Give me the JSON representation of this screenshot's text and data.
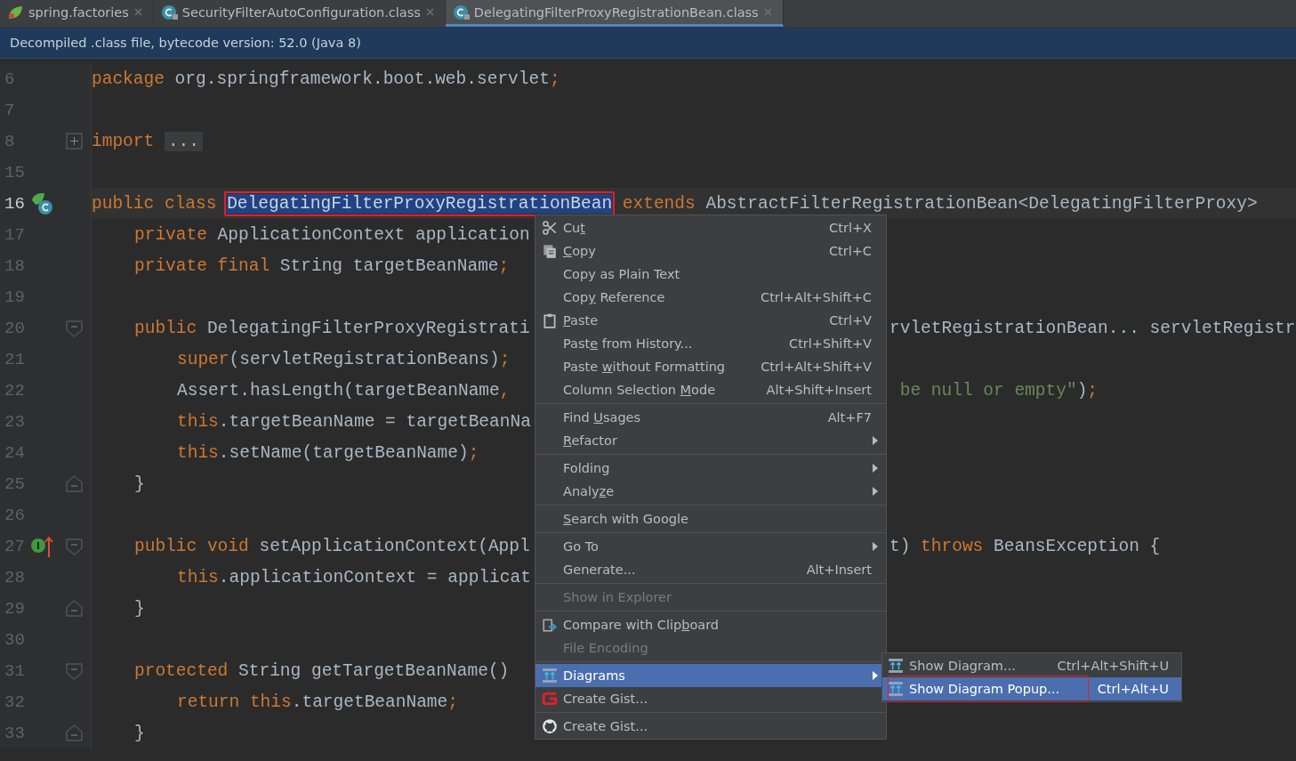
{
  "tabs": [
    {
      "label": "spring.factories",
      "kind": "spring",
      "selected": false
    },
    {
      "label": "SecurityFilterAutoConfiguration.class",
      "kind": "class",
      "selected": false
    },
    {
      "label": "DelegatingFilterProxyRegistrationBean.class",
      "kind": "class",
      "selected": true
    }
  ],
  "banner": "Decompiled .class file, bytecode version: 52.0 (Java 8)",
  "editor": {
    "lines": [
      {
        "number": "6",
        "tokens": [
          {
            "kind": "kw",
            "text": "package"
          },
          {
            "kind": "p",
            "text": " org.springframework.boot.web.servlet"
          },
          {
            "kind": "kw",
            "text": ";"
          }
        ]
      },
      {
        "number": "7"
      },
      {
        "number": "8",
        "fold": {
          "kind": "plus"
        },
        "tokens": [
          {
            "kind": "kw",
            "text": "import "
          },
          {
            "kind": "folded",
            "text": "..."
          }
        ]
      },
      {
        "number": "15"
      },
      {
        "number": "16",
        "current": true,
        "marker": {
          "kind": "class"
        },
        "tokens": [
          {
            "kind": "kw",
            "text": "public class "
          },
          {
            "kind": "sel",
            "text": "DelegatingFilterProxyRegistrationBean",
            "annotated": true
          },
          {
            "kind": "kw",
            "text": " extends"
          },
          {
            "kind": "p",
            "text": " AbstractFilterRegistrationBean<DelegatingFilterProxy>"
          }
        ]
      },
      {
        "number": "17",
        "kind": "member",
        "tokens": [
          {
            "kind": "kw",
            "text": "private"
          },
          {
            "kind": "p",
            "text": " ApplicationContext application"
          }
        ]
      },
      {
        "number": "18",
        "kind": "member",
        "tokens": [
          {
            "kind": "kw",
            "text": "private final"
          },
          {
            "kind": "p",
            "text": " String targetBeanName"
          },
          {
            "kind": "kw",
            "text": ";"
          }
        ]
      },
      {
        "number": "19"
      },
      {
        "number": "20",
        "fold": {
          "kind": "open"
        },
        "kind": "member",
        "tokens": [
          {
            "kind": "kw",
            "text": "public"
          },
          {
            "kind": "p",
            "text": " DelegatingFilterProxyRegistrati"
          }
        ],
        "right": [
          {
            "kind": "p",
            "text": "rvletRegistrationBean... servletRegistr"
          }
        ]
      },
      {
        "number": "21",
        "kind": "body",
        "tokens": [
          {
            "kind": "kw",
            "text": "super"
          },
          {
            "kind": "p",
            "text": "(servletRegistrationBeans)"
          },
          {
            "kind": "kw",
            "text": ";"
          }
        ]
      },
      {
        "number": "22",
        "kind": "body",
        "tokens": [
          {
            "kind": "p",
            "text": "Assert.hasLength(targetBeanName"
          },
          {
            "kind": "kw",
            "text": ","
          }
        ],
        "right": [
          {
            "kind": "str",
            "text": " be null or empty\""
          },
          {
            "kind": "p",
            "text": ")"
          },
          {
            "kind": "kw",
            "text": ";"
          }
        ]
      },
      {
        "number": "23",
        "kind": "body",
        "tokens": [
          {
            "kind": "kw",
            "text": "this"
          },
          {
            "kind": "p",
            "text": ".targetBeanName = targetBeanNa"
          }
        ]
      },
      {
        "number": "24",
        "kind": "body",
        "tokens": [
          {
            "kind": "kw",
            "text": "this"
          },
          {
            "kind": "p",
            "text": ".setName(targetBeanName)"
          },
          {
            "kind": "kw",
            "text": ";"
          }
        ]
      },
      {
        "number": "25",
        "fold": {
          "kind": "close"
        },
        "kind": "member",
        "tokens": [
          {
            "kind": "p",
            "text": "}"
          }
        ]
      },
      {
        "number": "26"
      },
      {
        "number": "27",
        "marker": {
          "kind": "implements"
        },
        "fold": {
          "kind": "open"
        },
        "kind": "member",
        "tokens": [
          {
            "kind": "kw",
            "text": "public void"
          },
          {
            "kind": "p",
            "text": " setApplicationContext(Appl"
          }
        ],
        "right": [
          {
            "kind": "p",
            "text": "t) "
          },
          {
            "kind": "kw",
            "text": "throws"
          },
          {
            "kind": "p",
            "text": " BeansException {"
          }
        ]
      },
      {
        "number": "28",
        "kind": "body",
        "tokens": [
          {
            "kind": "kw",
            "text": "this"
          },
          {
            "kind": "p",
            "text": ".applicationContext = applicat"
          }
        ]
      },
      {
        "number": "29",
        "fold": {
          "kind": "close"
        },
        "kind": "member",
        "tokens": [
          {
            "kind": "p",
            "text": "}"
          }
        ]
      },
      {
        "number": "30"
      },
      {
        "number": "31",
        "fold": {
          "kind": "open"
        },
        "kind": "member",
        "tokens": [
          {
            "kind": "kw",
            "text": "protected"
          },
          {
            "kind": "p",
            "text": " String getTargetBeanName()"
          }
        ]
      },
      {
        "number": "32",
        "kind": "body",
        "tokens": [
          {
            "kind": "kw",
            "text": "return this"
          },
          {
            "kind": "p",
            "text": ".targetBeanName"
          },
          {
            "kind": "kw",
            "text": ";"
          }
        ]
      },
      {
        "number": "33",
        "fold": {
          "kind": "close"
        },
        "kind": "member",
        "tokens": [
          {
            "kind": "p",
            "text": "}"
          }
        ]
      }
    ]
  },
  "context_menu": {
    "groups": [
      [
        {
          "kind": "cut",
          "pre": "Cu",
          "key": "t",
          "shortcut": "Ctrl+X",
          "disabled": false,
          "selected": false
        },
        {
          "kind": "copy",
          "key": "C",
          "post": "opy",
          "shortcut": "Ctrl+C",
          "disabled": false,
          "selected": false
        },
        {
          "pre": "Copy as Plain Text",
          "disabled": false,
          "selected": false
        },
        {
          "pre": "Cop",
          "key": "y",
          "post": " Reference",
          "shortcut": "Ctrl+Alt+Shift+C",
          "disabled": false,
          "selected": false
        },
        {
          "kind": "paste",
          "key": "P",
          "post": "aste",
          "shortcut": "Ctrl+V",
          "disabled": false,
          "selected": false
        },
        {
          "pre": "Past",
          "key": "e",
          "post": " from History...",
          "shortcut": "Ctrl+Shift+V",
          "disabled": false,
          "selected": false
        },
        {
          "pre": "Paste ",
          "key": "w",
          "post": "ithout Formatting",
          "shortcut": "Ctrl+Alt+Shift+V",
          "disabled": false,
          "selected": false
        },
        {
          "pre": "Column Selection ",
          "key": "M",
          "post": "ode",
          "shortcut": "Alt+Shift+Insert",
          "disabled": false,
          "selected": false
        }
      ],
      [
        {
          "pre": "Find ",
          "key": "U",
          "post": "sages",
          "shortcut": "Alt+F7",
          "disabled": false,
          "selected": false
        },
        {
          "key": "R",
          "post": "efactor",
          "submenu": true,
          "disabled": false,
          "selected": false
        }
      ],
      [
        {
          "pre": "Folding",
          "submenu": true,
          "disabled": false,
          "selected": false
        },
        {
          "pre": "Analy",
          "key": "z",
          "post": "e",
          "submenu": true,
          "disabled": false,
          "selected": false
        }
      ],
      [
        {
          "key": "S",
          "post": "earch with Google",
          "disabled": false,
          "selected": false
        }
      ],
      [
        {
          "pre": "Go To",
          "submenu": true,
          "disabled": false,
          "selected": false
        },
        {
          "pre": "Generate...",
          "shortcut": "Alt+Insert",
          "disabled": false,
          "selected": false
        }
      ],
      [
        {
          "pre": "Show in Explorer",
          "disabled": true,
          "selected": false
        }
      ],
      [
        {
          "kind": "compare",
          "pre": "Compare with Clip",
          "key": "b",
          "post": "oard",
          "disabled": false,
          "selected": false
        },
        {
          "pre": "File Encoding",
          "disabled": true,
          "selected": false
        }
      ],
      [
        {
          "kind": "diagram",
          "pre": "Diagrams",
          "submenu": true,
          "disabled": false,
          "selected": true
        },
        {
          "kind": "gist",
          "pre": "Create Gist...",
          "disabled": false,
          "selected": false
        }
      ],
      [
        {
          "kind": "github",
          "pre": "Create Gist...",
          "disabled": false,
          "selected": false
        }
      ]
    ]
  },
  "submenu": {
    "items": [
      {
        "kind": "diagram",
        "label": "Show Diagram...",
        "shortcut": "Ctrl+Alt+Shift+U",
        "selected": false,
        "annotated": false
      },
      {
        "kind": "diagram",
        "label": "Show Diagram Popup...",
        "shortcut": "Ctrl+Alt+U",
        "selected": true,
        "annotated": true
      }
    ]
  }
}
